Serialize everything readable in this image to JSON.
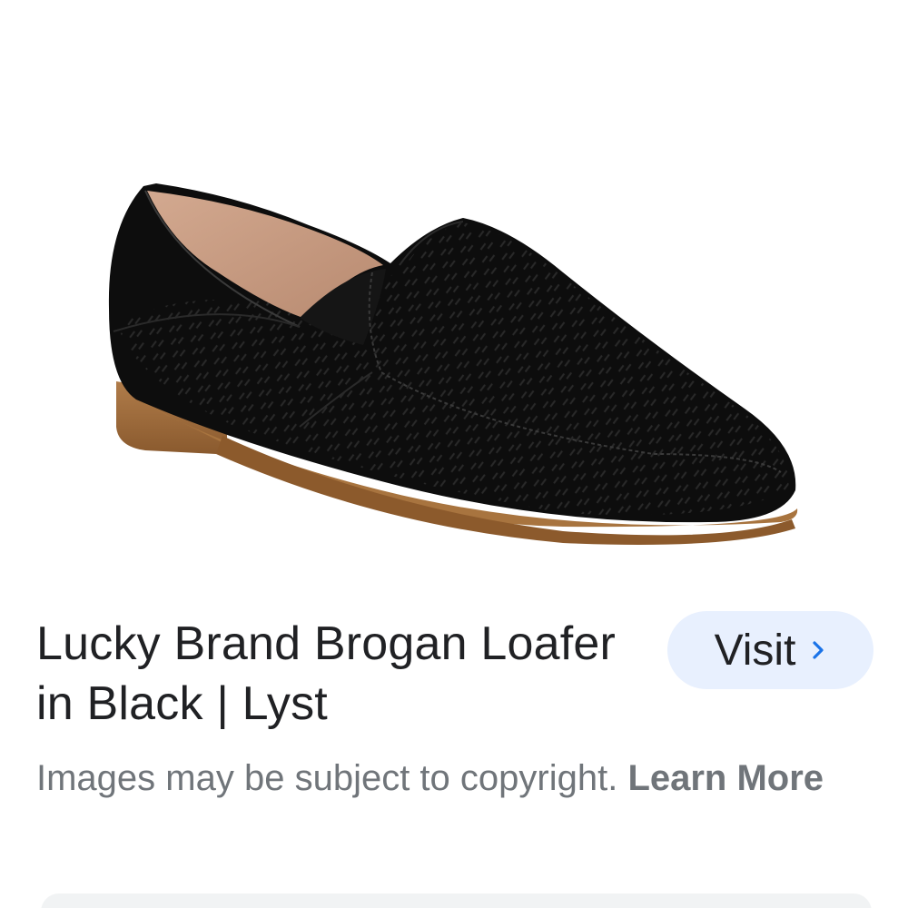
{
  "result": {
    "image_alt": "Black suede perforated loafer shoe",
    "title": "Lucky Brand Brogan Loafer in Black | Lyst",
    "visit_label": "Visit",
    "visit_icon": "chevron-right-icon",
    "copyright_text": "Images may be subject to copyright.",
    "learn_more_label": "Learn More"
  },
  "colors": {
    "visit_button_bg": "#e8f0fe",
    "accent": "#1a73e8",
    "muted_text": "#70757a",
    "title_text": "#202124"
  }
}
